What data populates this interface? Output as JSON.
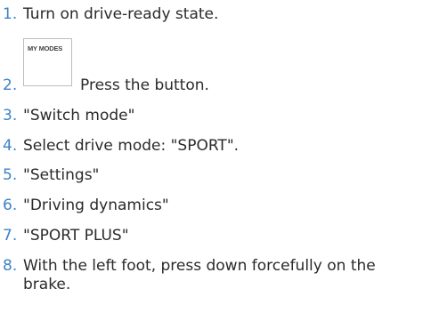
{
  "steps": [
    {
      "number": "1.",
      "text": "Turn on drive-ready state."
    },
    {
      "number": "2.",
      "text": "Press the button.",
      "button_label": "MY MODES"
    },
    {
      "number": "3.",
      "text": "\"Switch mode\""
    },
    {
      "number": "4.",
      "text": "Select drive mode: \"SPORT\"."
    },
    {
      "number": "5.",
      "text": "\"Settings\""
    },
    {
      "number": "6.",
      "text": "\"Driving dynamics\""
    },
    {
      "number": "7.",
      "text": "\"SPORT PLUS\""
    },
    {
      "number": "8.",
      "text": "With the left foot, press down forcefully on the brake."
    }
  ],
  "colors": {
    "number": "#3c82c8",
    "text": "#2a2a2a",
    "button_border": "#bdbdbd"
  }
}
